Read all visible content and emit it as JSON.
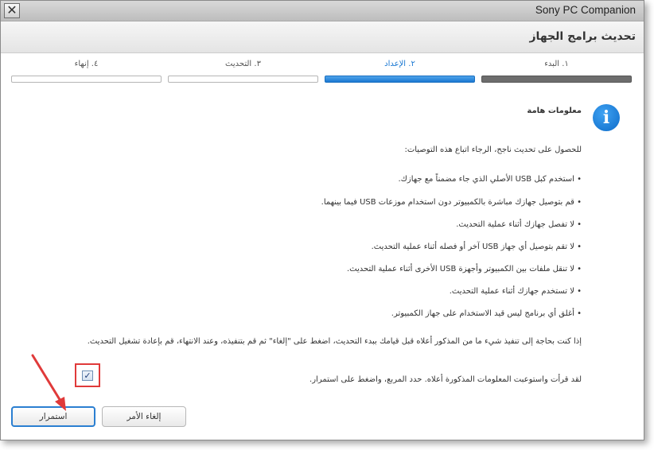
{
  "window": {
    "app_title": "Sony PC Companion",
    "close_glyph": "✕",
    "page_title": "تحديث برامج الجهاز"
  },
  "steps": [
    {
      "label": "١. البدء",
      "state": "done"
    },
    {
      "label": "٢. الإعداد",
      "state": "active"
    },
    {
      "label": "٣. التحديث",
      "state": "pending"
    },
    {
      "label": "٤. إنهاء",
      "state": "pending"
    }
  ],
  "info": {
    "icon": "info-icon",
    "icon_glyph": "i",
    "heading": "معلومات هامة"
  },
  "content": {
    "intro": "للحصول على تحديث ناجح، الرجاء اتباع هذه التوصيات:",
    "bullets": [
      "• استخدم كبل USB الأصلي الذي جاء مضمناً مع جهازك.",
      "• قم بتوصيل جهازك مباشرة بالكمبيوتر دون استخدام موزعات USB فيما بينهما.",
      "• لا تفصل جهازك أثناء عملية التحديث.",
      "• لا تقم بتوصيل أي جهاز USB آخر أو فصله أثناء عملية التحديث.",
      "• لا تنقل ملفات بين الكمبيوتر وأجهزة USB الأخرى أثناء عملية التحديث.",
      "• لا تستخدم جهازك أثناء عملية التحديث.",
      "• أغلق أي برنامج ليس قيد الاستخدام على جهاز الكمبيوتر."
    ],
    "note": "إذا كنت بحاجة إلى تنفيذ شيء ما من المذكور أعلاه قبل قيامك ببدء التحديث، اضغط على \"إلغاء\" ثم قم بتنفيذه، وعند الانتهاء، قم بإعادة تشغيل التحديث."
  },
  "confirm": {
    "checked": true,
    "check_glyph": "✓",
    "text": "لقد قرأت واستوعبت المعلومات المذكورة أعلاه. حدد المربع، واضغط على استمرار."
  },
  "buttons": {
    "continue_label": "استمرار",
    "cancel_label": "إلغاء الأمر"
  },
  "colors": {
    "accent": "#1a78d2",
    "highlight_annotation": "#e03a3a"
  }
}
